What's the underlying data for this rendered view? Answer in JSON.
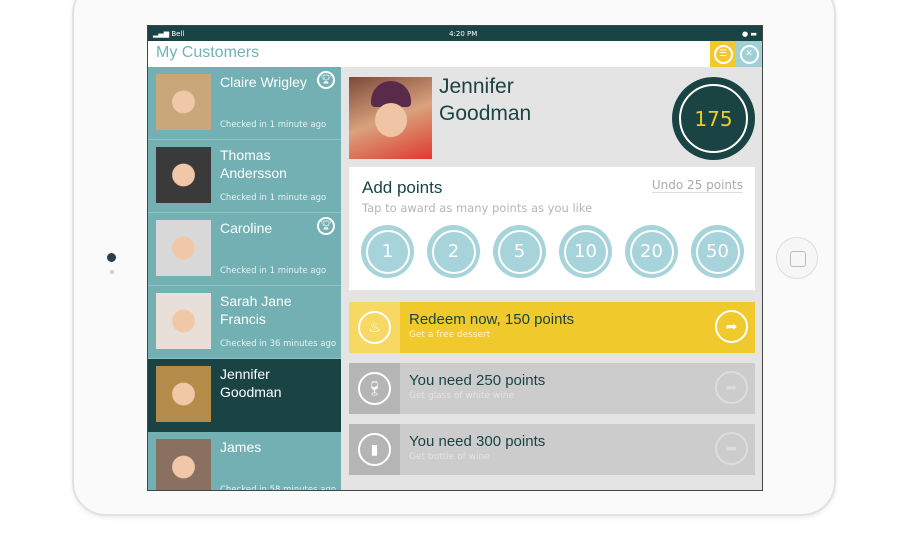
{
  "status": {
    "carrier": "Bell",
    "time": "4:20 PM"
  },
  "header": {
    "title": "My Customers",
    "list_icon": "list-icon",
    "tools_icon": "tools-icon"
  },
  "colors": {
    "dark_teal": "#1a4444",
    "teal": "#72b0b4",
    "yellow": "#f0ca2c",
    "light_blue": "#a6d4da"
  },
  "customers": [
    {
      "name": "Claire Wrigley",
      "checked": "Checked in 1 minute ago",
      "trophy": true
    },
    {
      "name": "Thomas Andersson",
      "checked": "Checked in 1 minute ago",
      "trophy": false
    },
    {
      "name": "Caroline",
      "checked": "Checked in 1 minute ago",
      "trophy": true
    },
    {
      "name": "Sarah Jane Francis",
      "checked": "Checked in 36 minutes ago",
      "trophy": false
    },
    {
      "name": "Jennifer Goodman",
      "checked": "",
      "trophy": false,
      "selected": true
    },
    {
      "name": "James",
      "checked": "Checked in 58 minutes ago",
      "trophy": false
    }
  ],
  "detail": {
    "name": "Jennifer Goodman",
    "points": "175",
    "add": {
      "title": "Add points",
      "undo": "Undo 25 points",
      "subtitle": "Tap to award as many points as you like",
      "values": [
        "1",
        "2",
        "5",
        "10",
        "20",
        "50"
      ]
    },
    "rewards": [
      {
        "title": "Redeem now, 150 points",
        "subtitle": "Get a free dessert",
        "icon": "cupcake-icon",
        "available": true
      },
      {
        "title": "You need 250 points",
        "subtitle": "Get glass of white wine",
        "icon": "wine-glass-icon",
        "available": false
      },
      {
        "title": "You need 300 points",
        "subtitle": "Get bottle of wine",
        "icon": "wine-bottle-icon",
        "available": false
      }
    ]
  }
}
